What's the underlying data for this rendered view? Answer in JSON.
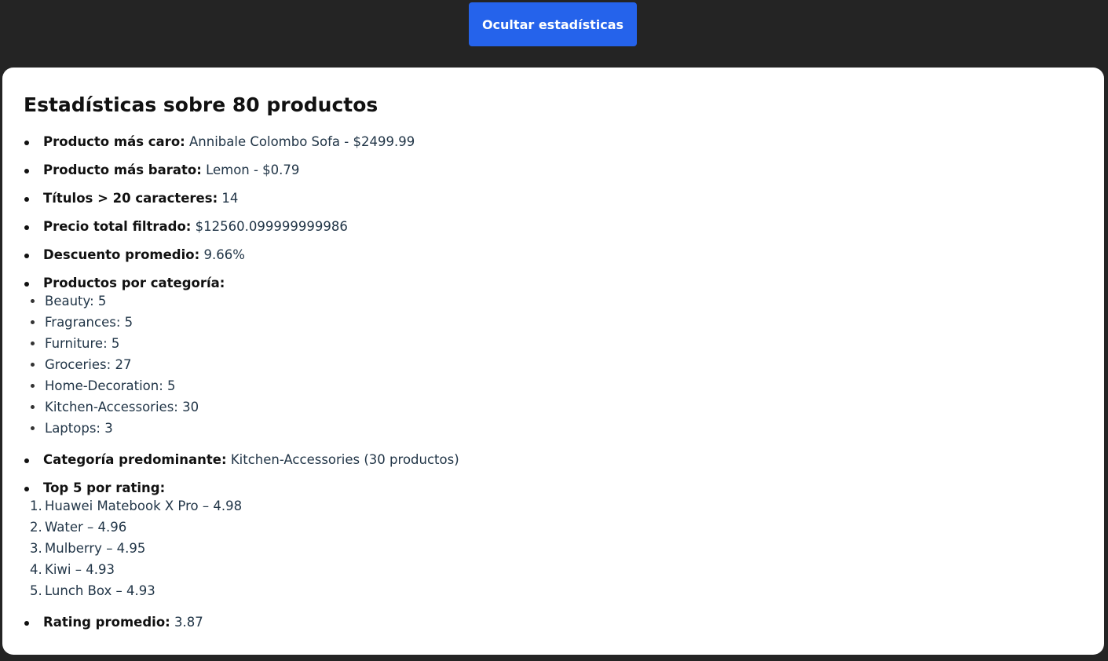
{
  "toggle_button_label": "Ocultar estadísticas",
  "title": "Estadísticas sobre 80 productos",
  "stats": {
    "most_expensive": {
      "label": "Producto más caro:",
      "value": "Annibale Colombo Sofa - $2499.99"
    },
    "cheapest": {
      "label": "Producto más barato:",
      "value": "Lemon - $0.79"
    },
    "long_titles": {
      "label": "Títulos > 20 caracteres:",
      "value": "14"
    },
    "total_price": {
      "label": "Precio total filtrado:",
      "value": "$12560.099999999986"
    },
    "avg_discount": {
      "label": "Descuento promedio:",
      "value": "9.66%"
    },
    "by_category": {
      "label": "Productos por categoría:",
      "items": [
        "Beauty: 5",
        "Fragrances: 5",
        "Furniture: 5",
        "Groceries: 27",
        "Home-Decoration: 5",
        "Kitchen-Accessories: 30",
        "Laptops: 3"
      ]
    },
    "top_category": {
      "label": "Categoría predominante:",
      "value": "Kitchen-Accessories (30 productos)"
    },
    "top_rated": {
      "label": "Top 5 por rating:",
      "numbers": [
        "1.",
        "2.",
        "3.",
        "4.",
        "5."
      ],
      "items": [
        "Huawei Matebook X Pro – 4.98",
        "Water – 4.96",
        "Mulberry – 4.95",
        "Kiwi – 4.93",
        "Lunch Box – 4.93"
      ]
    },
    "avg_rating": {
      "label": "Rating promedio:",
      "value": "3.87"
    }
  },
  "colors": {
    "page_background": "#242424",
    "card_background": "#ffffff",
    "button_background": "#2563eb",
    "button_text": "#ffffff"
  }
}
